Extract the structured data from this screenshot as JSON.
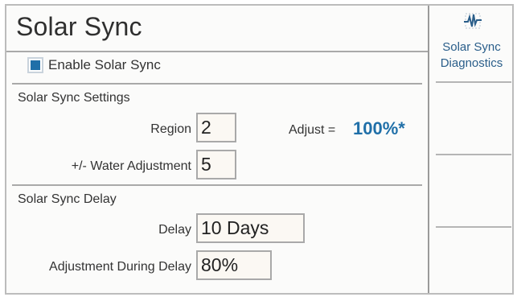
{
  "screen": {
    "title": "Solar Sync"
  },
  "enable": {
    "label": "Enable Solar Sync",
    "checked": true
  },
  "settings": {
    "section_title": "Solar Sync Settings",
    "region_label": "Region",
    "region_value": "2",
    "water_adjust_label": "+/- Water Adjustment",
    "water_adjust_value": "5",
    "adjust_label": "Adjust =",
    "adjust_value": "100%*"
  },
  "delay": {
    "section_title": "Solar Sync Delay",
    "delay_label": "Delay",
    "delay_value": "10 Days",
    "during_delay_label": "Adjustment During Delay",
    "during_delay_value": "80%"
  },
  "softkeys": {
    "diagnostics_label_line1": "Solar Sync",
    "diagnostics_label_line2": "Diagnostics",
    "diagnostics_icon": "diagnostics-waveform-icon"
  },
  "colors": {
    "accent": "#1f6fa8",
    "border": "#a9a9a9",
    "background": "#fbfbfa"
  }
}
